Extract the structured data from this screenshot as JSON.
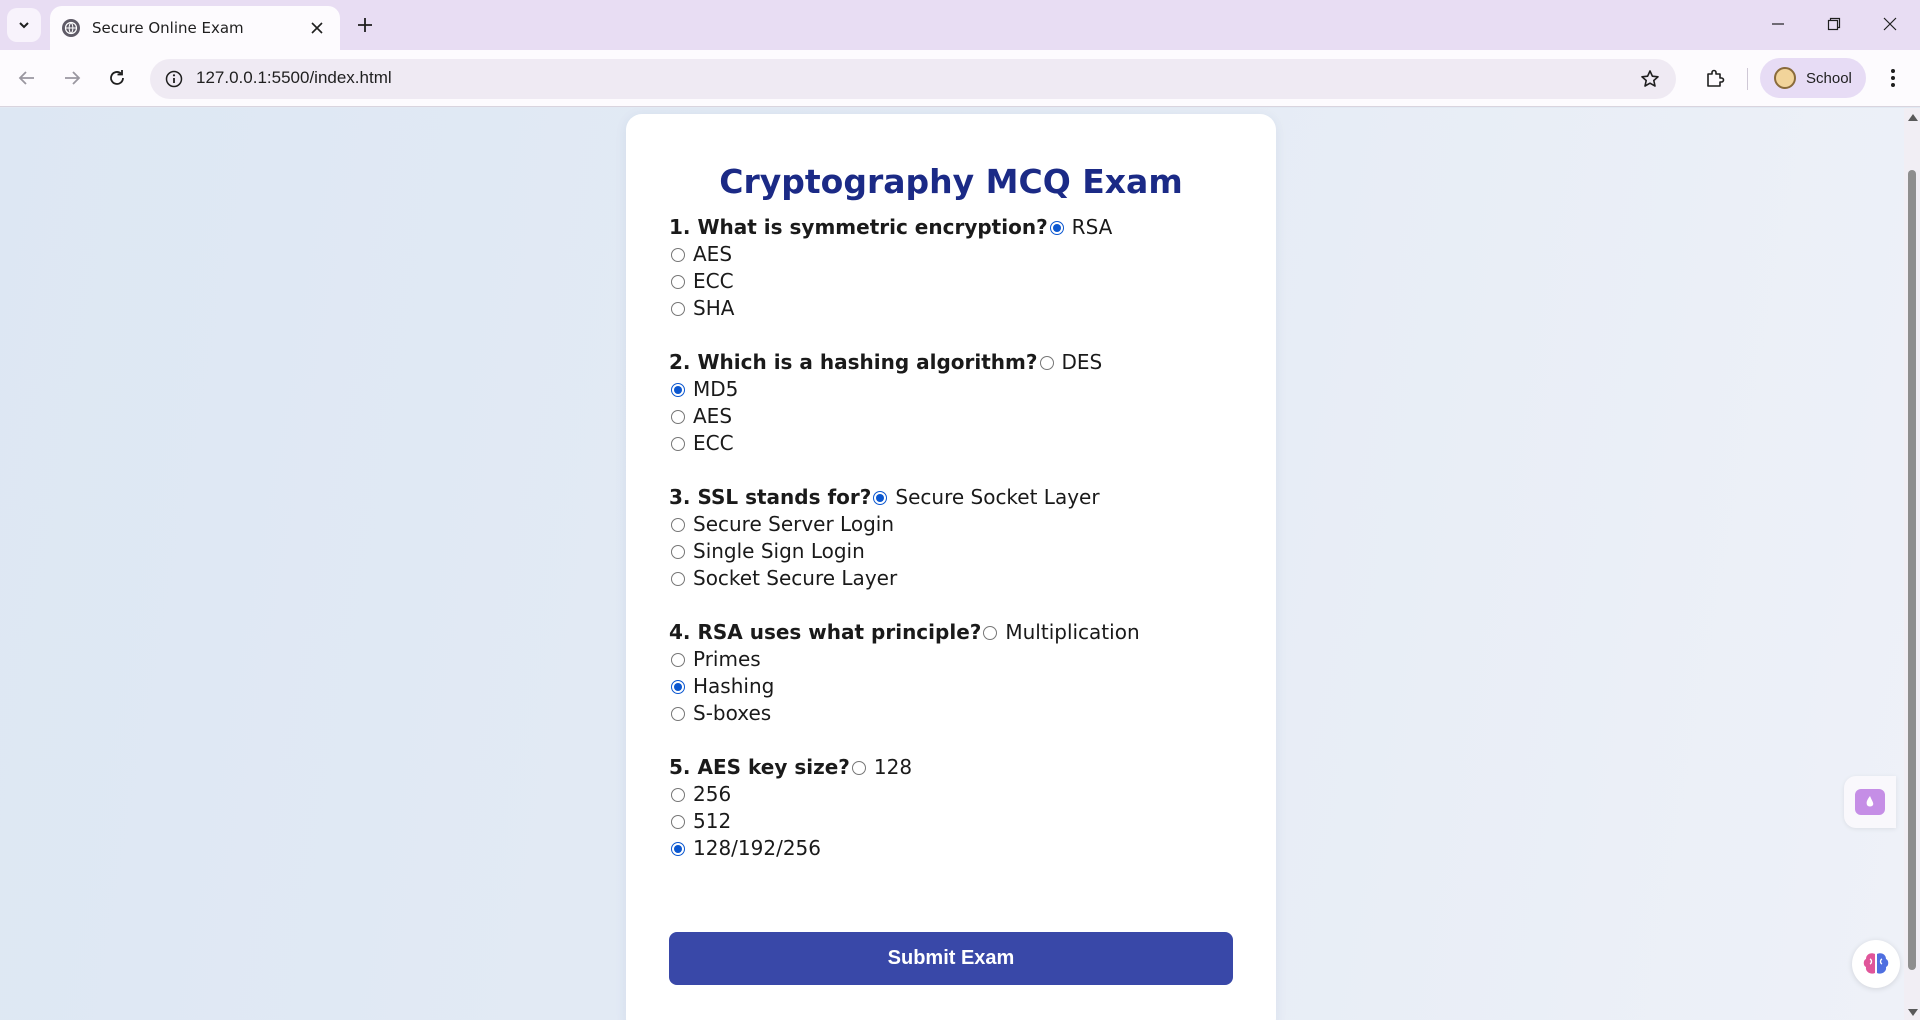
{
  "browser": {
    "tab_title": "Secure Online Exam",
    "url": "127.0.0.1:5500/index.html",
    "profile_label": "School"
  },
  "exam": {
    "title": "Cryptography MCQ Exam",
    "questions": [
      {
        "text": "1. What is symmetric encryption?",
        "options": [
          "RSA",
          "AES",
          "ECC",
          "SHA"
        ],
        "selected": 0
      },
      {
        "text": "2. Which is a hashing algorithm?",
        "options": [
          "DES",
          "MD5",
          "AES",
          "ECC"
        ],
        "selected": 1
      },
      {
        "text": "3. SSL stands for?",
        "options": [
          "Secure Socket Layer",
          "Secure Server Login",
          "Single Sign Login",
          "Socket Secure Layer"
        ],
        "selected": 0
      },
      {
        "text": "4. RSA uses what principle?",
        "options": [
          "Multiplication",
          "Primes",
          "Hashing",
          "S-boxes"
        ],
        "selected": 2
      },
      {
        "text": "5. AES key size?",
        "options": [
          "128",
          "256",
          "512",
          "128/192/256"
        ],
        "selected": 3
      }
    ],
    "submit_label": "Submit Exam"
  },
  "colors": {
    "title": "#1b2a86",
    "submit_bg": "#3948a8",
    "radio_checked": "#0b57d0"
  }
}
